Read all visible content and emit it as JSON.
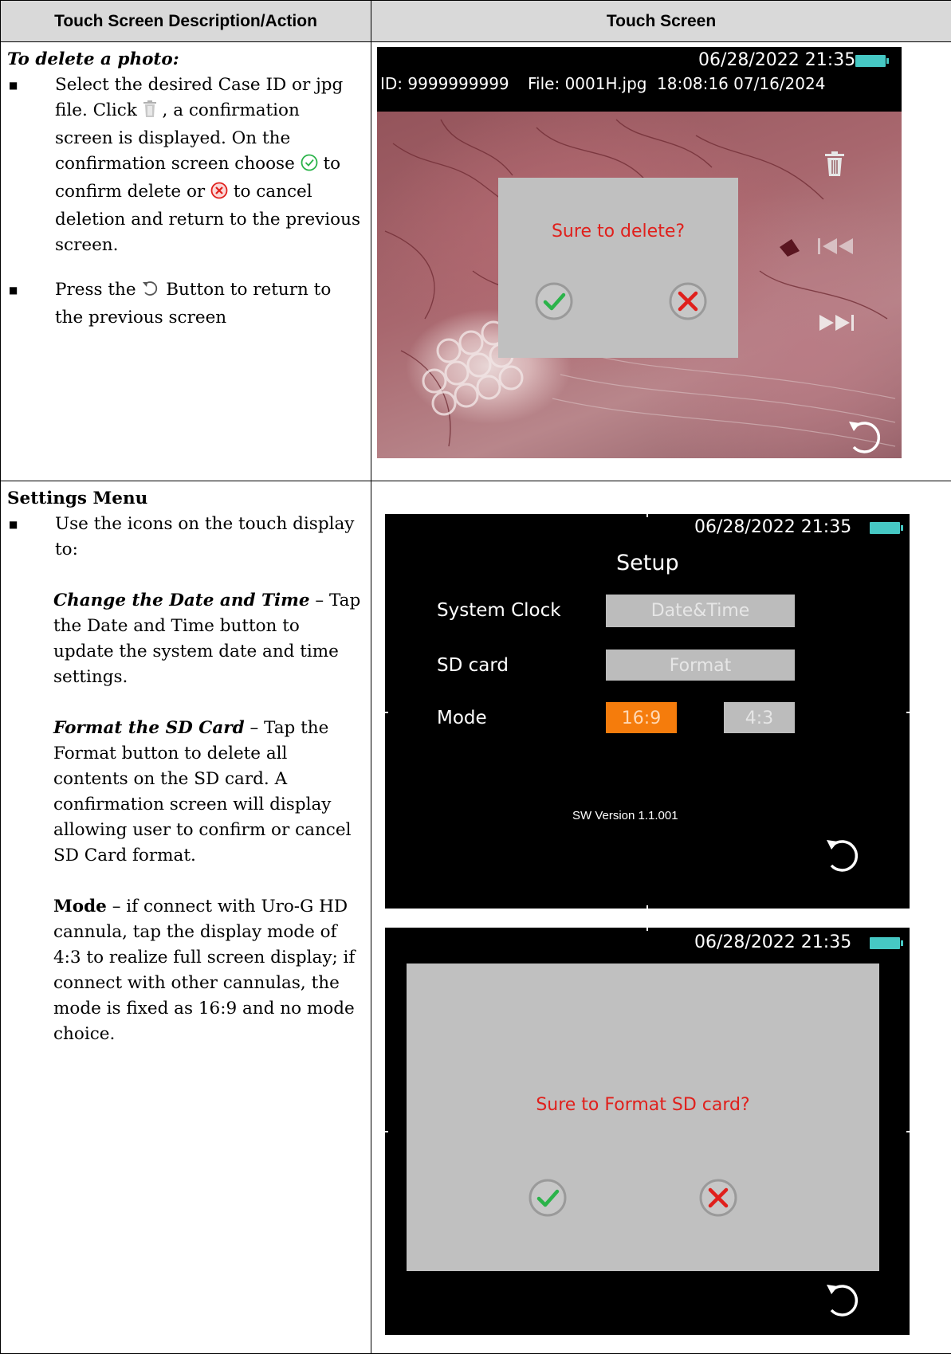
{
  "header": {
    "col1": "Touch Screen Description/Action",
    "col2": "Touch Screen"
  },
  "row1": {
    "title": "To delete a photo:",
    "bullet1_a": "Select the desired Case ID or jpg file. Click ",
    "bullet1_b": " , a confirmation screen is displayed. On the confirmation screen choose ",
    "bullet1_c": " to confirm delete or ",
    "bullet1_d": " to cancel deletion and return to the previous screen.",
    "bullet2_a": "Press the ",
    "bullet2_b": " Button to return to the previous screen"
  },
  "screen1": {
    "datetime": "06/28/2022   21:35",
    "id": "ID: 9999999999",
    "file": "File: 0001H.jpg",
    "timestamp": "18:08:16  07/16/2024",
    "dialog_message": "Sure to delete?"
  },
  "row2": {
    "title": "Settings Menu",
    "bullet1": "Use the icons on the touch display to:",
    "sub1_title": "Change the Date and Time",
    "sub1_text": " – Tap the Date and Time button to update the system date and time settings.",
    "sub2_title": "Format the SD Card",
    "sub2_text": " – Tap the Format button to delete all contents on the SD card. A confirmation screen will display allowing user to confirm or cancel SD Card format.",
    "sub3_title": "Mode",
    "sub3_text": " – if connect with Uro-G HD cannula, tap the display mode of 4:3 to realize full screen display; if connect with other cannulas, the mode is fixed as 16:9 and no mode choice."
  },
  "screen2": {
    "datetime": "06/28/2022   21:35",
    "title": "Setup",
    "clock_label": "System  Clock",
    "clock_button": "Date&Time",
    "sd_label": "SD card",
    "sd_button": "Format",
    "mode_label": "Mode",
    "mode_option1": "16:9",
    "mode_option2": "4:3",
    "version": "SW Version 1.1.001"
  },
  "screen3": {
    "datetime": "06/28/2022   21:35",
    "dialog_message": "Sure to Format SD card?"
  },
  "colors": {
    "confirm_green": "#2bb34a",
    "cancel_red": "#e0201c",
    "battery": "#46c8c4",
    "active_mode": "#f57c0c"
  }
}
